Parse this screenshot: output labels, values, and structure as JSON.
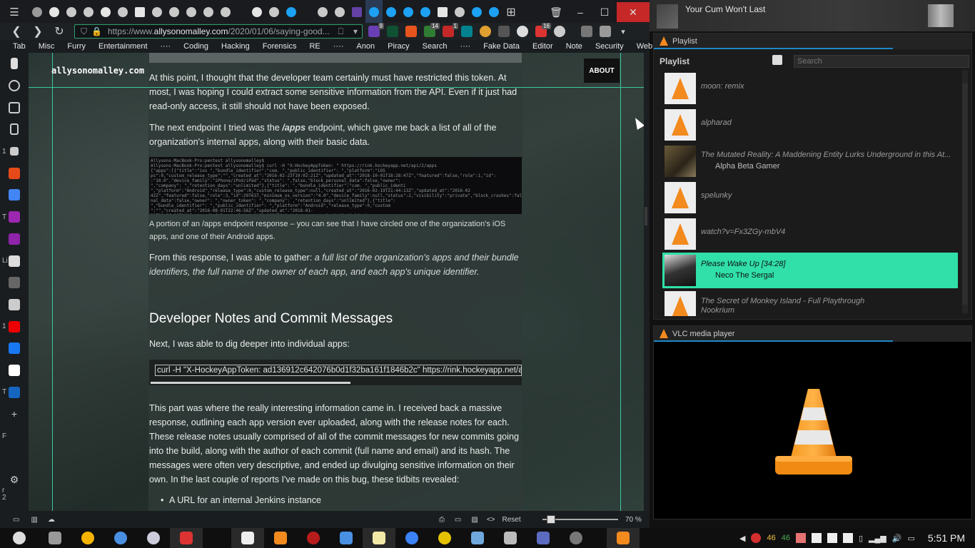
{
  "browser": {
    "url_prefix": "https://www.",
    "url_domain": "allysonomalley.com",
    "url_rest": "/2020/01/06/saying-good...",
    "bookmarks": [
      "Tab",
      "Misc",
      "Furry",
      "Entertainment",
      "····",
      "Coding",
      "Hacking",
      "Forensics",
      "RE",
      "····",
      "Anon",
      "Piracy",
      "Search",
      "····",
      "Fake Data",
      "Editor",
      "Note",
      "Security",
      "Web",
      "····"
    ],
    "ext_badges": [
      "9",
      "14",
      "1",
      "16"
    ],
    "sidebar_labels": [
      "1",
      "T",
      "Li",
      "1",
      "T",
      "F",
      "r",
      "2"
    ]
  },
  "page": {
    "site_title": "allysonomalley.com",
    "about": "ABOUT",
    "p1": "At this point, I thought that the developer team certainly must have restricted this token. At most, I was hoping I could extract some sensitive information from the API. Even if it just had read-only access, it still should not have been exposed.",
    "p2_a": "The next endpoint I tried was the ",
    "p2_b": "/apps",
    "p2_c": " endpoint, which gave me back a list of all of the organization's internal apps, along with their basic data.",
    "code_lines": [
      "Allysons-MacBook-Pro:pentest allysonomalley$",
      "Allysons-MacBook-Pro:pentest allysonomalley$ curl -H \"X-HockeyAppToken:                       \" https://rink.hockeyapp.net/api/2/apps",
      "{\"apps\":[{\"title\":\"ios          \",\"bundle_identifier\":\"com.             \",\"public_identifier\":                          \",\"platform\":\"iOS",
      "ps\":0,\"custom_release_type\":\"\",\"created_at\":\"2016-02-23T19:02:21Z\",\"updated_at\":\"2018-10-01T18:28:47Z\",\"featured\":false,\"role\":1,\"id\":",
      ":\"10.0\",\"device_family\":\"iPhone/iPod/iPad\",\"status\":            \",false,\"block_personal_data\":false,\"owner\":",
      "               \",\"company\":           \",\"retention_days\":\"unlimited\"},{\"title\":         \",\"bundle_identifier\":\"com.       \",\"public_identi",
      "                \",\"platform\":\"Android\",\"release_type\":0,\"custom_release_type\":null,\"created_at\":\"2016-02-19T21:44:13Z\",\"updated_at\":\"2016-02",
      "42Z\",\"featured\":false,\"role\":3,\"id\":297637,\"minimum_os_version\":\"4.0\",\"device_family\":null,\"status\":2,\"visibility\":\"private\",\"block_crashes\":false,",
      "nal_data\":false,\"owner\":           \",\"owner_token\":                  \",\"company\":                ,\"retention_days\":\"unlimited\"},{\"title\":",
      "           \",\"bundle_identifier\":              \",\"public_identifier\":                     \",\"platform\":\"Android\",\"release_type\":0,\"custom",
      "\":\"\",\"created_at\":\"2016-08-01T22:46:56Z\",\"updated_at\":\"2018-01-01T06:36:08Z\",\"featured\":false,\"role\":1,\"id\":369434,\"minimum_os_version\":\"4.4\",\"devi"
    ],
    "caption": "A portion of an /apps endpoint response – you can see that I have circled one of the organization's iOS apps, and one of their Android apps.",
    "p3_a": "From this response, I was able to gather: ",
    "p3_b": "a full list of the organization's apps and their bundle identifiers, the full name of the owner of each app, and each app's unique identifier.",
    "heading": "Developer Notes and Commit Messages",
    "p4": "Next, I was able to dig deeper into individual apps:",
    "curl": "curl -H \"X-HockeyAppToken: ad136912c642076b0d1f32ba161f1846b2c\" https://rink.hockeyapp.net/api/",
    "p5": "This part was where the really interesting information came in. I received back a massive response, outlining each app version ever uploaded, along with the release notes for each. These release notes usually comprised of all of the commit messages for new commits going into the build, along with the author of each commit (full name and email) and its hash. The messages were often very descriptive, and ended up divulging sensitive information on their own. In the last couple of reports I've made on this bug, these tidbits revealed:",
    "bullet1": "A URL for an internal Jenkins instance"
  },
  "statusbar": {
    "reset": "Reset",
    "zoom": "70 %",
    "zoom_fraction": 0.06
  },
  "now_playing": {
    "title": "Your Cum Won't Last"
  },
  "playlist": {
    "window_title": "Playlist",
    "heading": "Playlist",
    "search_placeholder": "Search",
    "items": [
      {
        "name": "moon: remix",
        "artist": ""
      },
      {
        "name": "alpharad",
        "artist": ""
      },
      {
        "name": "The Mutated Reality: A Maddening Entity Lurks Underground in this At...",
        "artist": "Alpha Beta Gamer"
      },
      {
        "name": "spelunky",
        "artist": ""
      },
      {
        "name": "watch?v=Fx3ZGy-mbV4",
        "artist": ""
      },
      {
        "name": "Please Wake Up [34:28]",
        "artist": "Neco The Sergal"
      },
      {
        "name": "The Secret of Monkey Island - Full Playthrough",
        "artist": "Nookrium"
      }
    ]
  },
  "vlc": {
    "window_title": "VLC media player"
  },
  "tray": {
    "count1": "46",
    "count2": "46",
    "clock": "5:51 PM"
  },
  "colors": {
    "accent": "#38c9a0",
    "playlist_selected": "#30e0a8",
    "close": "#c62828"
  }
}
